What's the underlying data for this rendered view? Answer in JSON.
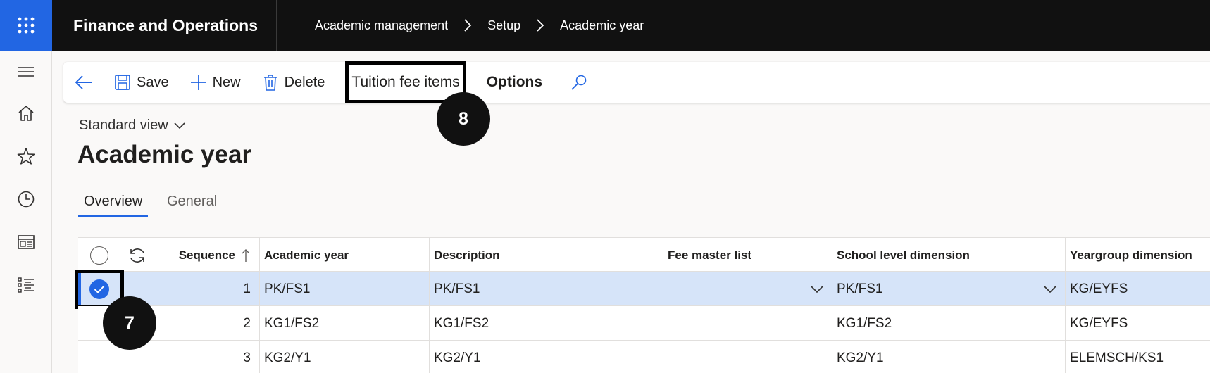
{
  "app": {
    "title": "Finance and Operations"
  },
  "breadcrumb": [
    "Academic management",
    "Setup",
    "Academic year"
  ],
  "actions": {
    "save": "Save",
    "new": "New",
    "delete": "Delete",
    "tuition_fee_items": "Tuition fee items",
    "options": "Options"
  },
  "annotations": {
    "badge_action": "8",
    "badge_row": "7"
  },
  "view": {
    "name": "Standard view"
  },
  "page": {
    "title": "Academic year"
  },
  "tabs": [
    "Overview",
    "General"
  ],
  "grid": {
    "columns": [
      "Sequence",
      "Academic year",
      "Description",
      "Fee master list",
      "School level dimension",
      "Yeargroup dimension"
    ],
    "rows": [
      {
        "sequence": "1",
        "academic_year": "PK/FS1",
        "description": "PK/FS1",
        "fee_master_list": "",
        "school_level": "PK/FS1",
        "yeargroup": "KG/EYFS",
        "selected": true
      },
      {
        "sequence": "2",
        "academic_year": "KG1/FS2",
        "description": "KG1/FS2",
        "fee_master_list": "",
        "school_level": "KG1/FS2",
        "yeargroup": "KG/EYFS",
        "selected": false
      },
      {
        "sequence": "3",
        "academic_year": "KG2/Y1",
        "description": "KG2/Y1",
        "fee_master_list": "",
        "school_level": "KG2/Y1",
        "yeargroup": "ELEMSCH/KS1",
        "selected": false
      }
    ]
  },
  "colors": {
    "accent": "#2266e3",
    "topbar": "#111111",
    "selected_row": "#d6e4f9"
  },
  "icons": [
    "app-launcher-icon",
    "chevron-right-icon",
    "hamburger-icon",
    "home-icon",
    "star-icon",
    "clock-icon",
    "workspace-icon",
    "modules-icon",
    "back-arrow-icon",
    "save-icon",
    "plus-icon",
    "delete-icon",
    "search-icon",
    "chevron-down-icon",
    "refresh-icon",
    "sort-up-icon",
    "check-icon"
  ]
}
